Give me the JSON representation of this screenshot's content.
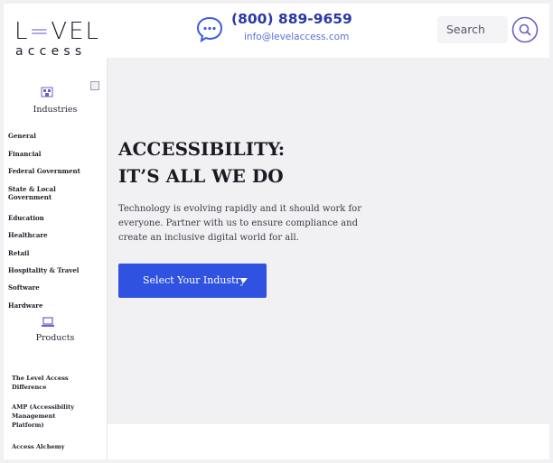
{
  "brand": {
    "logo_top": "LEVEL",
    "logo_bottom": "access",
    "accent": "#5d4fd6"
  },
  "header": {
    "phone": "(800) 889-9659",
    "email": "info@levelaccess.com",
    "search_label": "Search"
  },
  "sidebar": {
    "industries_title": "Industries",
    "industries": [
      "General",
      "Financial",
      "Federal Government",
      "State & Local Government",
      "Education",
      "Healthcare",
      "Retail",
      "Hospitality & Travel",
      "Software",
      "Hardware"
    ],
    "products_title": "Products",
    "products": [
      "The Level Access Difference",
      "AMP (Accessibility Management Platform)",
      "Access Alchemy"
    ]
  },
  "hero": {
    "title_line1": "ACCESSIBILITY:",
    "title_line2": "IT’S ALL WE DO",
    "body": "Technology is evolving rapidly and it should work for everyone. Partner with us to ensure compliance and create an inclusive digital world for all.",
    "cta_label": "Select Your Industry"
  },
  "colors": {
    "primary": "#3052e0",
    "phone": "#2a39a8",
    "hero_bg": "#f1f1f4"
  }
}
